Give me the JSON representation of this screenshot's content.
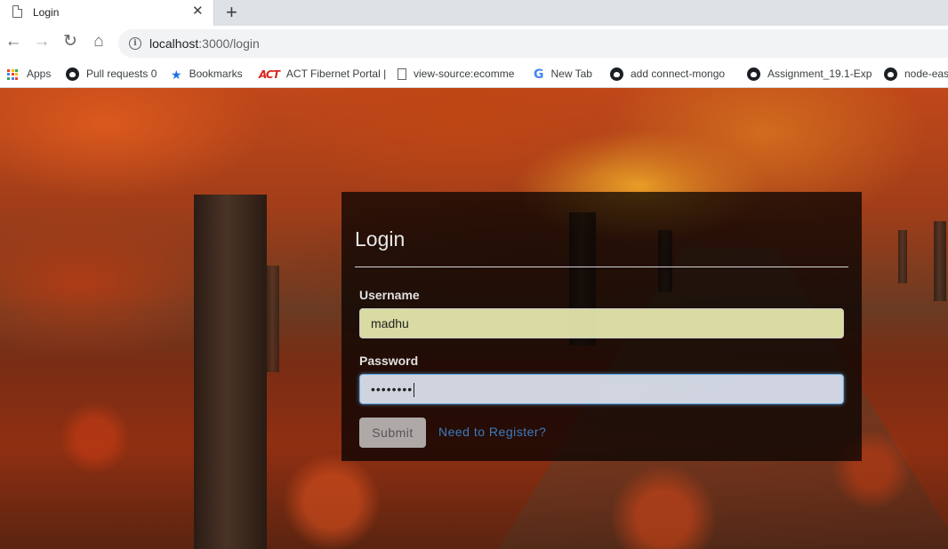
{
  "browser": {
    "tab_title": "Login",
    "close_glyph": "✕",
    "newtab_glyph": "+",
    "url_host": "localhost",
    "url_path": ":3000/login",
    "bookmarks": [
      {
        "label": "Apps",
        "icon": "apps-grid-icon"
      },
      {
        "label": "Pull requests 0",
        "icon": "github-icon"
      },
      {
        "label": "Bookmarks",
        "icon": "star-icon"
      },
      {
        "label": "ACT Fibernet Portal |",
        "icon": "act-logo-icon"
      },
      {
        "label": "view-source:ecomme",
        "icon": "page-icon"
      },
      {
        "label": "New Tab",
        "icon": "google-icon"
      },
      {
        "label": "add connect-mongo",
        "icon": "github-icon"
      },
      {
        "label": "Assignment_19.1-Exp",
        "icon": "github-icon"
      },
      {
        "label": "node-eas",
        "icon": "github-icon"
      }
    ]
  },
  "login": {
    "title": "Login",
    "username_label": "Username",
    "username_value": "madhu",
    "password_label": "Password",
    "password_value": "••••••••",
    "submit_label": "Submit",
    "register_link": "Need to Register?"
  },
  "colors": {
    "panel_bg": "#000000",
    "link": "#3a7cc1",
    "username_autofill": "#fafebd",
    "password_focus": "#66afe9"
  }
}
